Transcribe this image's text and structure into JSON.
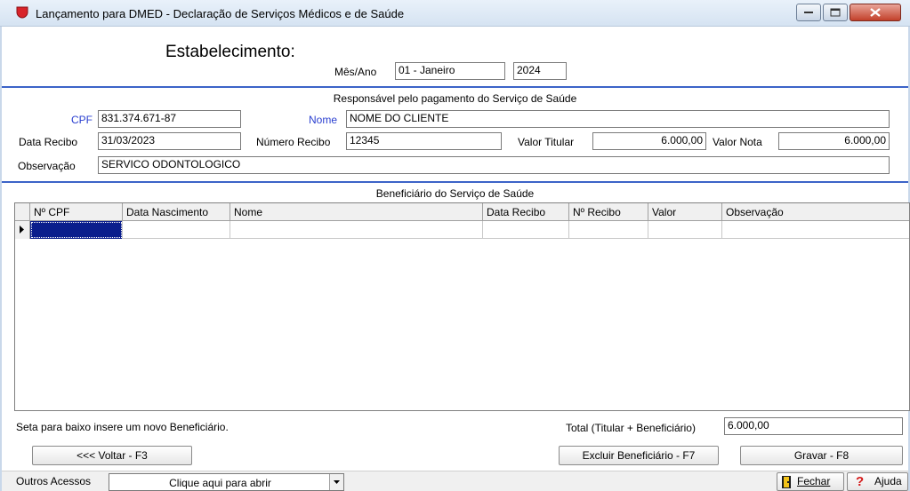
{
  "window": {
    "title": "Lançamento para DMED - Declaração de Serviços Médicos e de Saúde"
  },
  "header": {
    "estabelecimento_label": "Estabelecimento:",
    "mes_ano_label": "Mês/Ano",
    "mes_value": "01 - Janeiro",
    "ano_value": "2024"
  },
  "responsavel": {
    "section_title": "Responsável pelo pagamento do Serviço de Saúde",
    "cpf_label": "CPF",
    "cpf_value": "831.374.671-87",
    "nome_label": "Nome",
    "nome_value": "NOME DO CLIENTE",
    "data_recibo_label": "Data Recibo",
    "data_recibo_value": "31/03/2023",
    "numero_recibo_label": "Número Recibo",
    "numero_recibo_value": "12345",
    "valor_titular_label": "Valor Titular",
    "valor_titular_value": "6.000,00",
    "valor_nota_label": "Valor Nota",
    "valor_nota_value": "6.000,00",
    "observacao_label": "Observação",
    "observacao_value": "SERVICO ODONTOLOGICO"
  },
  "beneficiario": {
    "section_title": "Beneficiário do Serviço de Saúde",
    "columns": [
      "Nº CPF",
      "Data Nascimento",
      "Nome",
      "Data Recibo",
      "Nº Recibo",
      "Valor",
      "Observação"
    ]
  },
  "footer": {
    "hint": "Seta para baixo insere um novo Beneficiário.",
    "total_label": "Total (Titular + Beneficiário)",
    "total_value": "6.000,00",
    "voltar_label": "<<< Voltar - F3",
    "excluir_label": "Excluir Beneficiário - F7",
    "gravar_label": "Gravar - F8"
  },
  "bottom": {
    "outros_acessos_label": "Outros Acessos",
    "combo_value": "Clique aqui para abrir",
    "fechar_label": "Fechar",
    "ajuda_label": "Ajuda"
  },
  "colors": {
    "accent_blue": "#2a3fd0",
    "section_line": "#3c63c8",
    "selected_cell": "#0a1e8c"
  }
}
